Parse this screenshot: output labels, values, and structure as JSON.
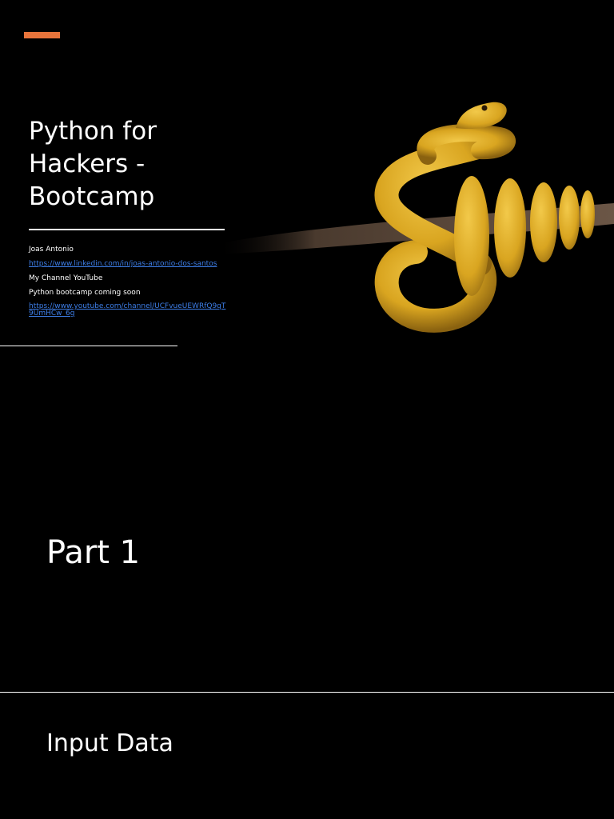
{
  "slide1": {
    "title": "Python for Hackers - Bootcamp",
    "author": "Joas Antonio",
    "linkedin_url": "https://www.linkedin.com/in/joas-antonio-dos-santos",
    "channel_label": "My Channel YouTube",
    "bootcamp_note": "Python bootcamp coming soon",
    "youtube_url": "https://www.youtube.com/channel/UCFvueUEWRfQ9qT9UmHCw_6g",
    "accent_color": "#e8743b",
    "image": "yellow-python-snake-on-branch"
  },
  "slide2": {
    "heading": "Part 1"
  },
  "slide3": {
    "heading": "Input Data"
  }
}
